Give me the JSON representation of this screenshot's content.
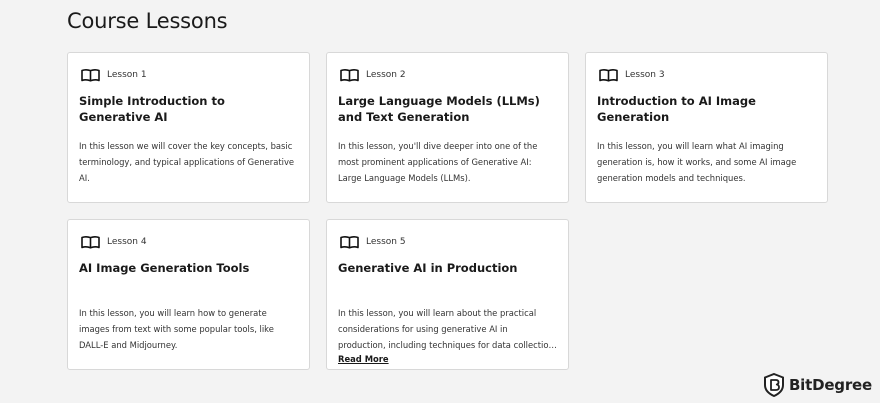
{
  "page": {
    "title": "Course Lessons"
  },
  "lessons": [
    {
      "label": "Lesson 1",
      "title": "Simple Introduction to Generative AI",
      "description": "In this lesson we will cover the key concepts, basic terminology, and typical applications of Generative AI.",
      "icon": "book-icon"
    },
    {
      "label": "Lesson 2",
      "title": "Large Language Models (LLMs) and Text Generation",
      "description": "In this lesson, you'll dive deeper into one of the most prominent applications of Generative AI: Large Language Models (LLMs).",
      "icon": "book-icon"
    },
    {
      "label": "Lesson 3",
      "title": "Introduction to AI Image Generation",
      "description": "In this lesson, you will learn what AI imaging generation is, how it works, and some AI image generation models and techniques.",
      "icon": "book-icon"
    },
    {
      "label": "Lesson 4",
      "title": "AI Image Generation Tools",
      "description": "In this lesson, you will learn how to generate images from text with some popular tools, like DALL-E and Midjourney.",
      "icon": "book-icon"
    },
    {
      "label": "Lesson 5",
      "title": "Generative AI in Production",
      "description": "In this lesson, you will learn about the practical considerations for using generative AI in production, including techniques for data collection, prompt...",
      "icon": "book-icon",
      "read_more": "Read More"
    }
  ],
  "brand": {
    "name": "BitDegree",
    "icon": "bitdegree-shield-logo"
  }
}
